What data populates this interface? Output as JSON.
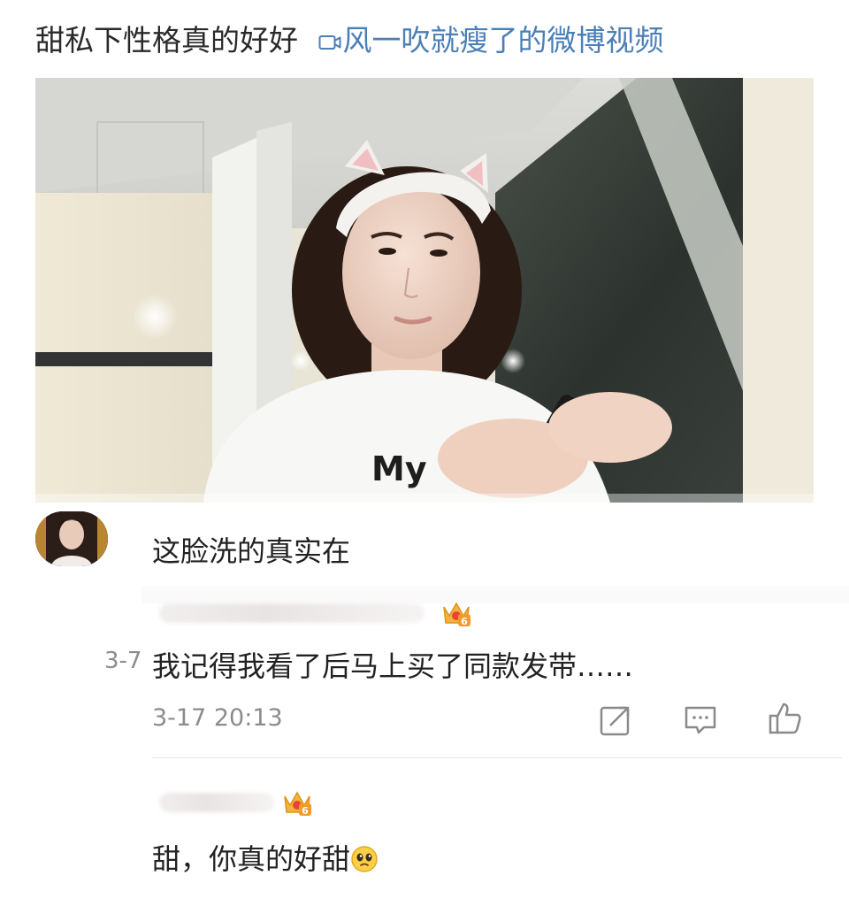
{
  "post": {
    "title": "甜私下性格真的好好",
    "video_link": "风一吹就瘦了的微博视频",
    "video_icon": "video-icon"
  },
  "video": {
    "shirt_text": "My"
  },
  "comments": [
    {
      "text": "这脸洗的真实在"
    },
    {
      "side_date": "3-7",
      "text": "我记得我看了后马上买了同款发带……",
      "timestamp": "3-17 20:13",
      "badge": "6",
      "actions": [
        "share-icon",
        "comment-icon",
        "like-icon"
      ]
    },
    {
      "text": "甜，你真的好甜",
      "badge": "6",
      "emoji": "pleading-face-emoji"
    }
  ],
  "colors": {
    "link": "#4a7fb8",
    "text": "#222222",
    "muted": "#8c8c8c"
  }
}
